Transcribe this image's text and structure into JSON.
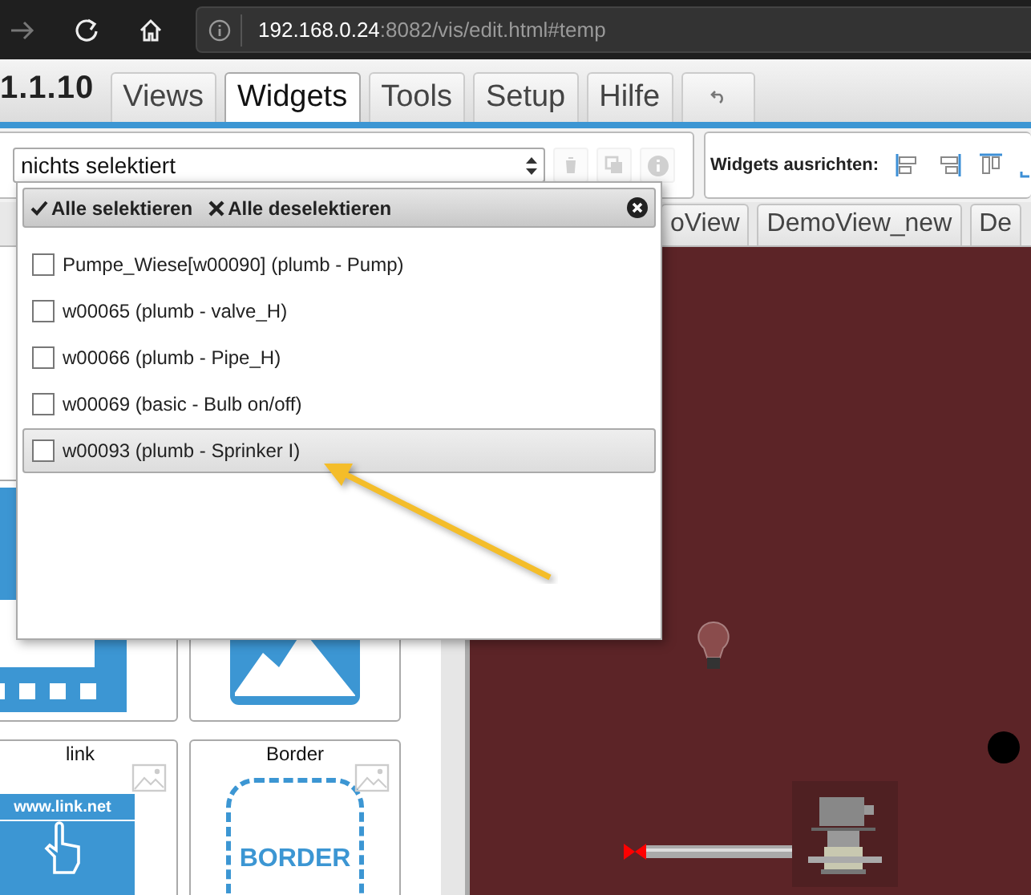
{
  "browser": {
    "url_host": "192.168.0.24",
    "url_rest": ":8082/vis/edit.html#temp"
  },
  "app": {
    "version": "1.1.10"
  },
  "menu_tabs": [
    {
      "label": "Views",
      "selected": false
    },
    {
      "label": "Widgets",
      "selected": true
    },
    {
      "label": "Tools",
      "selected": false
    },
    {
      "label": "Setup",
      "selected": false
    },
    {
      "label": "Hilfe",
      "selected": false
    }
  ],
  "toolbar": {
    "select_value": "nichts selektiert",
    "align_label": "Widgets ausrichten:",
    "buttons": [
      {
        "kind": "delete",
        "disabled": true
      },
      {
        "kind": "copy",
        "disabled": true
      },
      {
        "kind": "info",
        "disabled": true
      }
    ]
  },
  "view_tabs": [
    {
      "label": "oView"
    },
    {
      "label": "DemoView_new"
    },
    {
      "label": "De"
    }
  ],
  "palette": [
    {
      "kind": "iframe"
    },
    {
      "kind": "image"
    },
    {
      "kind": "link",
      "label": "link",
      "text": "www.link.net"
    },
    {
      "kind": "border",
      "label": "Border",
      "text": "BORDER"
    }
  ],
  "canvas": {
    "widgets": [
      {
        "kind": "bulb"
      },
      {
        "kind": "dot"
      },
      {
        "kind": "pipe"
      },
      {
        "kind": "pump"
      }
    ]
  },
  "popup": {
    "select_all": "Alle selektieren",
    "deselect_all": "Alle deselektieren",
    "items": [
      {
        "label": "Pumpe_Wiese[w00090] (plumb - Pump)",
        "checked": false,
        "selected": false
      },
      {
        "label": "w00065 (plumb - valve_H)",
        "checked": false,
        "selected": false
      },
      {
        "label": "w00066 (plumb - Pipe_H)",
        "checked": false,
        "selected": false
      },
      {
        "label": "w00069 (basic - Bulb on/off)",
        "checked": false,
        "selected": false
      },
      {
        "label": "w00093 (plumb - Sprinker I)",
        "checked": false,
        "selected": true
      }
    ]
  }
}
